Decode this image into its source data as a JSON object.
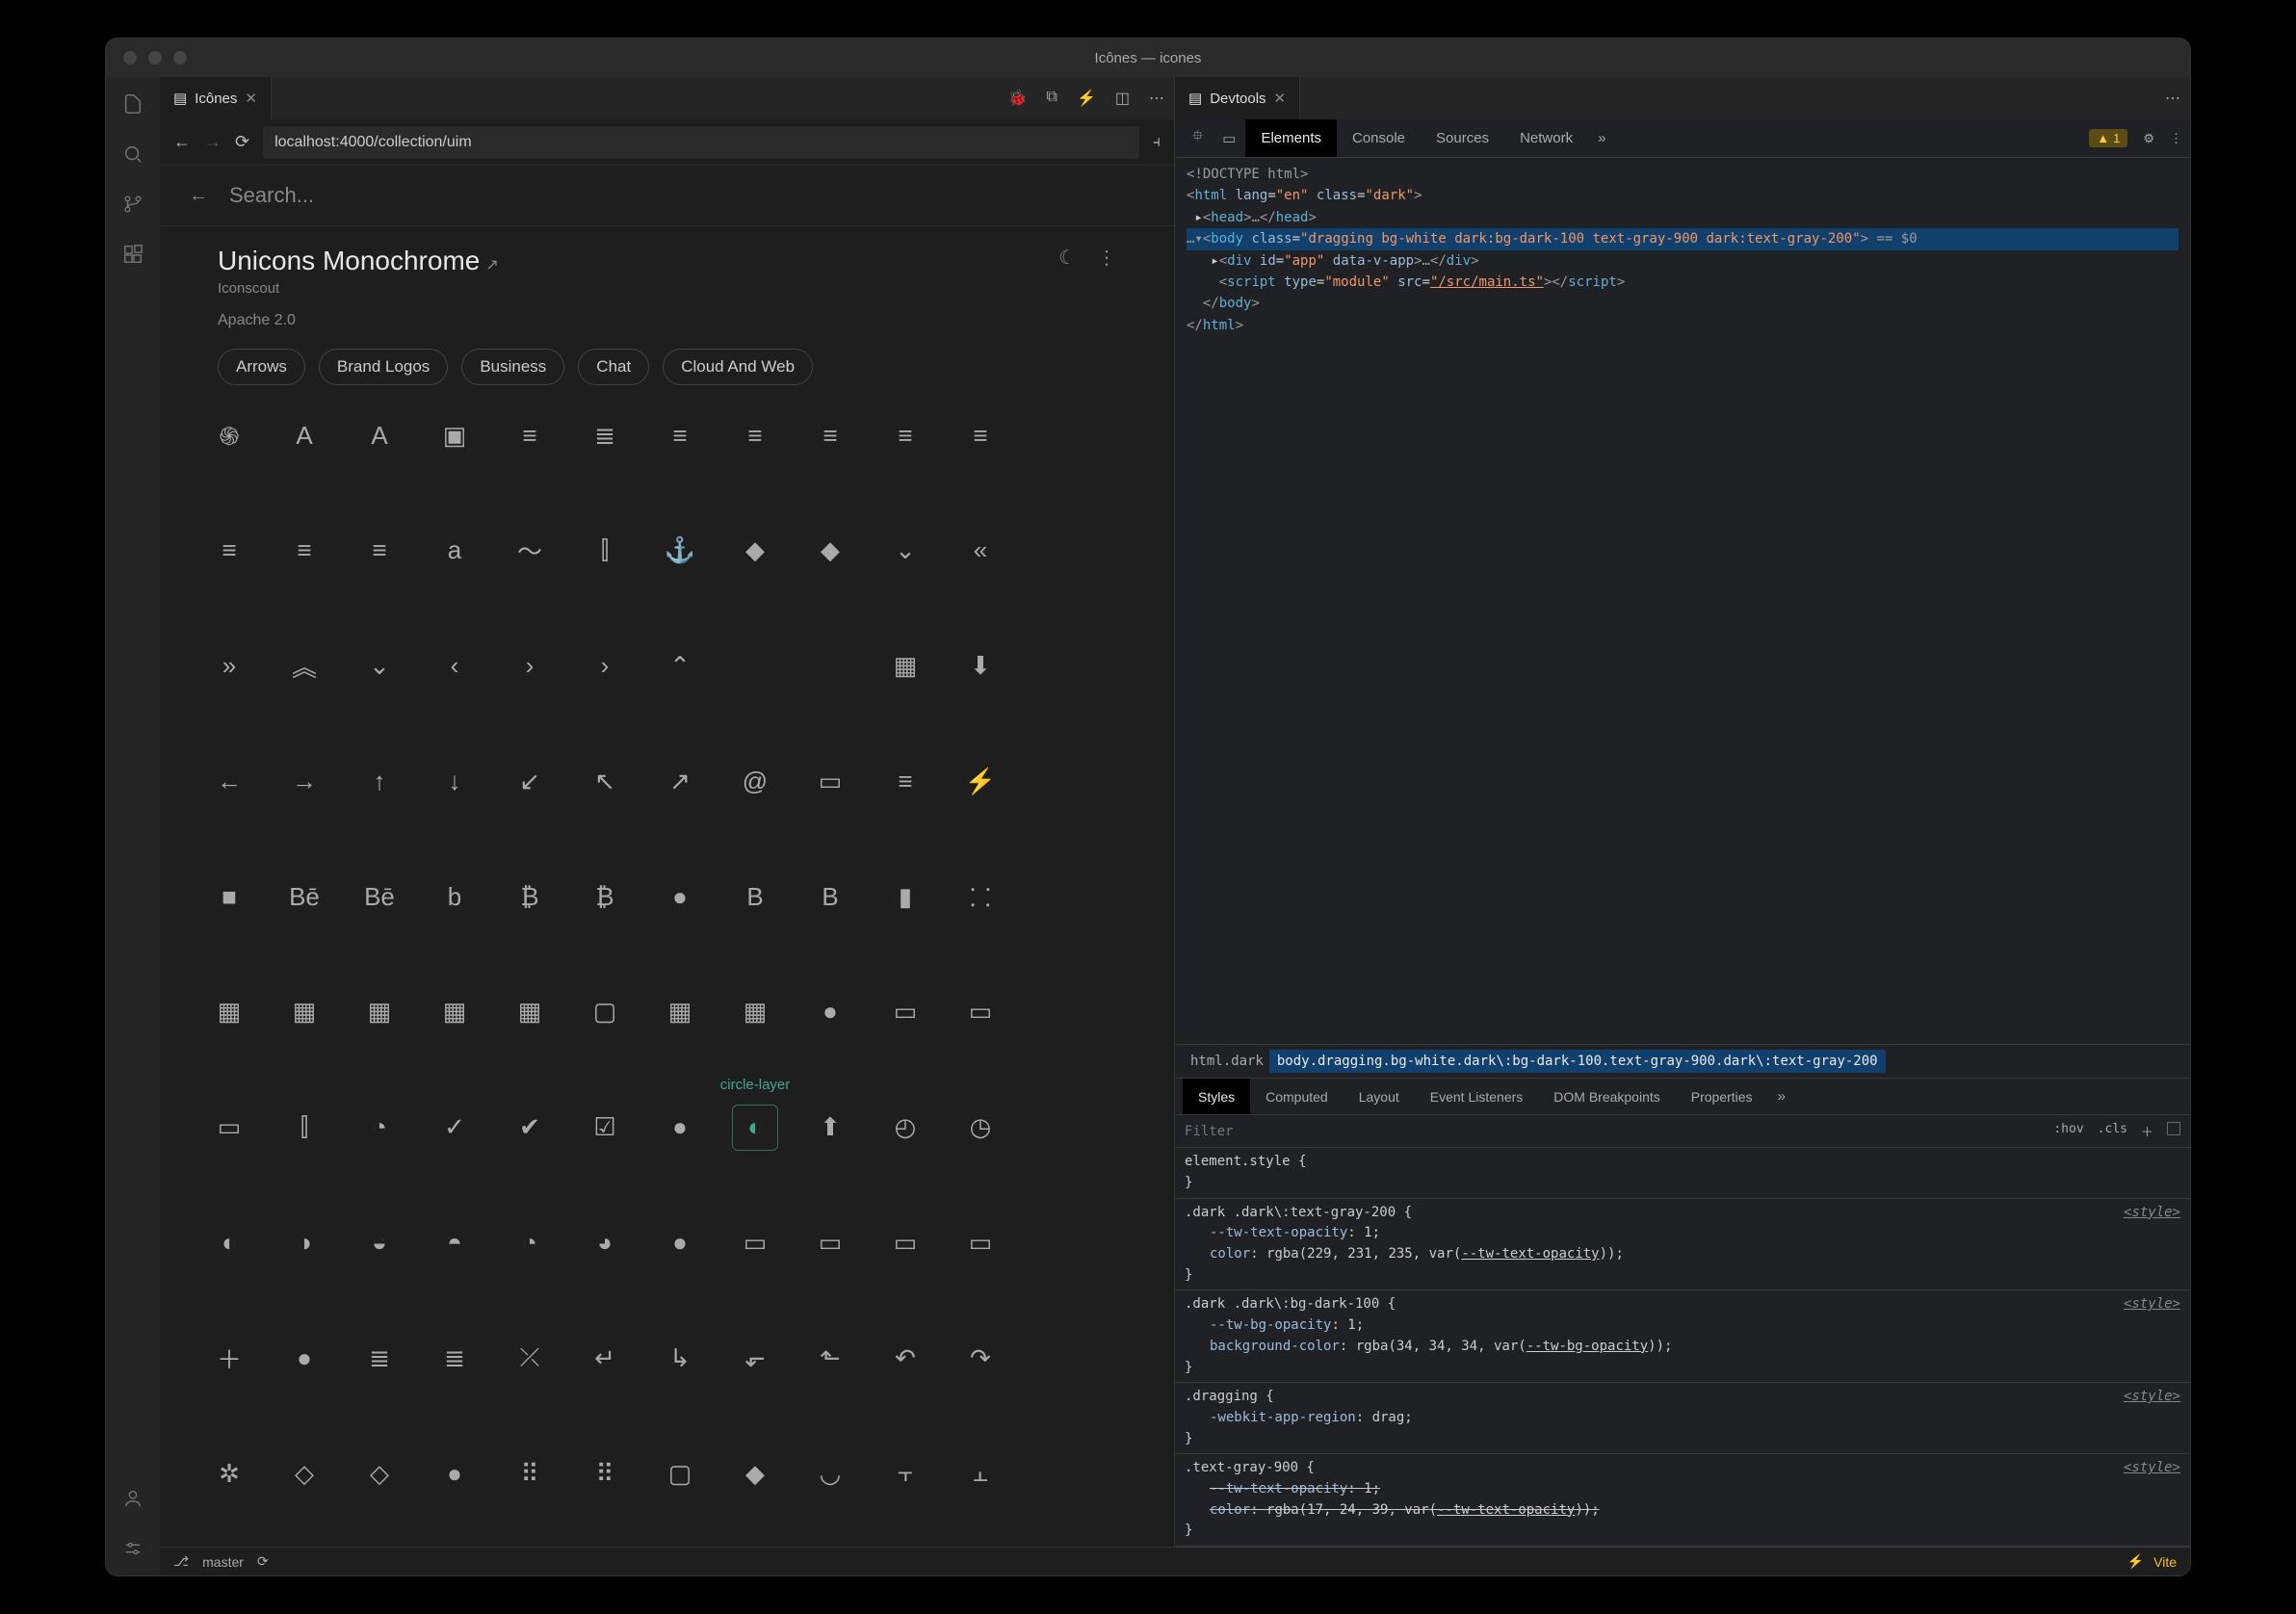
{
  "title": "Icônes — icones",
  "tabs": {
    "left": {
      "label": "Icônes"
    },
    "right": {
      "label": "Devtools"
    }
  },
  "browser": {
    "url": "localhost:4000/collection/uim"
  },
  "icones": {
    "search_placeholder": "Search...",
    "collection_title": "Unicons Monochrome",
    "collection_author": "Iconscout",
    "license": "Apache 2.0",
    "chips": [
      "Arrows",
      "Brand Logos",
      "Business",
      "Chat",
      "Cloud And Web"
    ],
    "hovered_icon_tooltip": "circle-layer"
  },
  "devtools": {
    "tabs": [
      "Elements",
      "Console",
      "Sources",
      "Network"
    ],
    "active_tab": "Elements",
    "warning_count": "1",
    "dom": {
      "l1": "<!DOCTYPE html>",
      "l2a": "<html ",
      "l2_attr1": "lang",
      "l2_val1": "\"en\"",
      "l2_attr2": "class",
      "l2_val2": "\"dark\"",
      "l2b": ">",
      "l3a": "▸<head>",
      "l3b": "…",
      "l3c": "</head>",
      "l4_pre": "…▾",
      "l4a": "<body ",
      "l4_attr": "class",
      "l4_val": "\"dragging bg-white dark:bg-dark-100 text-gray-900 dark:text-gray-200\"",
      "l4b": ">",
      "l4_sel": " == $0",
      "l5a": "▸<div ",
      "l5_attr1": "id",
      "l5_val1": "\"app\"",
      "l5_attr2": "data-v-app",
      "l5b": ">…</div>",
      "l6a": "<script ",
      "l6_attr1": "type",
      "l6_val1": "\"module\"",
      "l6_attr2": "src",
      "l6_val2": "\"/src/main.ts\"",
      "l6b": "></script>",
      "l7": "</body>",
      "l8": "</html>"
    },
    "breadcrumb": [
      "html.dark",
      "body.dragging.bg-white.dark\\:bg-dark-100.text-gray-900.dark\\:text-gray-200"
    ],
    "sub_tabs": [
      "Styles",
      "Computed",
      "Layout",
      "Event Listeners",
      "DOM Breakpoints",
      "Properties"
    ],
    "active_sub_tab": "Styles",
    "filter_placeholder": "Filter",
    "filter_actions": {
      "hov": ":hov",
      "cls": ".cls"
    },
    "styles": {
      "element_style": "element.style {",
      "r1_sel": ".dark .dark\\:text-gray-200 {",
      "r1_p1": "--tw-text-opacity",
      "r1_v1": "1",
      "r1_p2": "color",
      "r1_v2a": "rgba(229, 231, 235, var(",
      "r1_v2b": "--tw-text-opacity",
      "r1_v2c": "))",
      "r2_sel": ".dark .dark\\:bg-dark-100 {",
      "r2_p1": "--tw-bg-opacity",
      "r2_v1": "1",
      "r2_p2": "background-color",
      "r2_v2a": "rgba(34, 34, 34, var(",
      "r2_v2b": "--tw-bg-opacity",
      "r2_v2c": "))",
      "r3_sel": ".dragging {",
      "r3_p1": "-webkit-app-region",
      "r3_v1": "drag",
      "r4_sel": ".text-gray-900 {",
      "r4_p1": "--tw-text-opacity",
      "r4_v1": "1",
      "r4_p2": "color",
      "r4_v2a": "rgba(17, 24, 39, var(",
      "r4_v2b": "--tw-text-opacity",
      "r4_v2c": "))",
      "src": "<style>"
    }
  },
  "statusbar": {
    "branch": "master",
    "vite": "Vite"
  }
}
